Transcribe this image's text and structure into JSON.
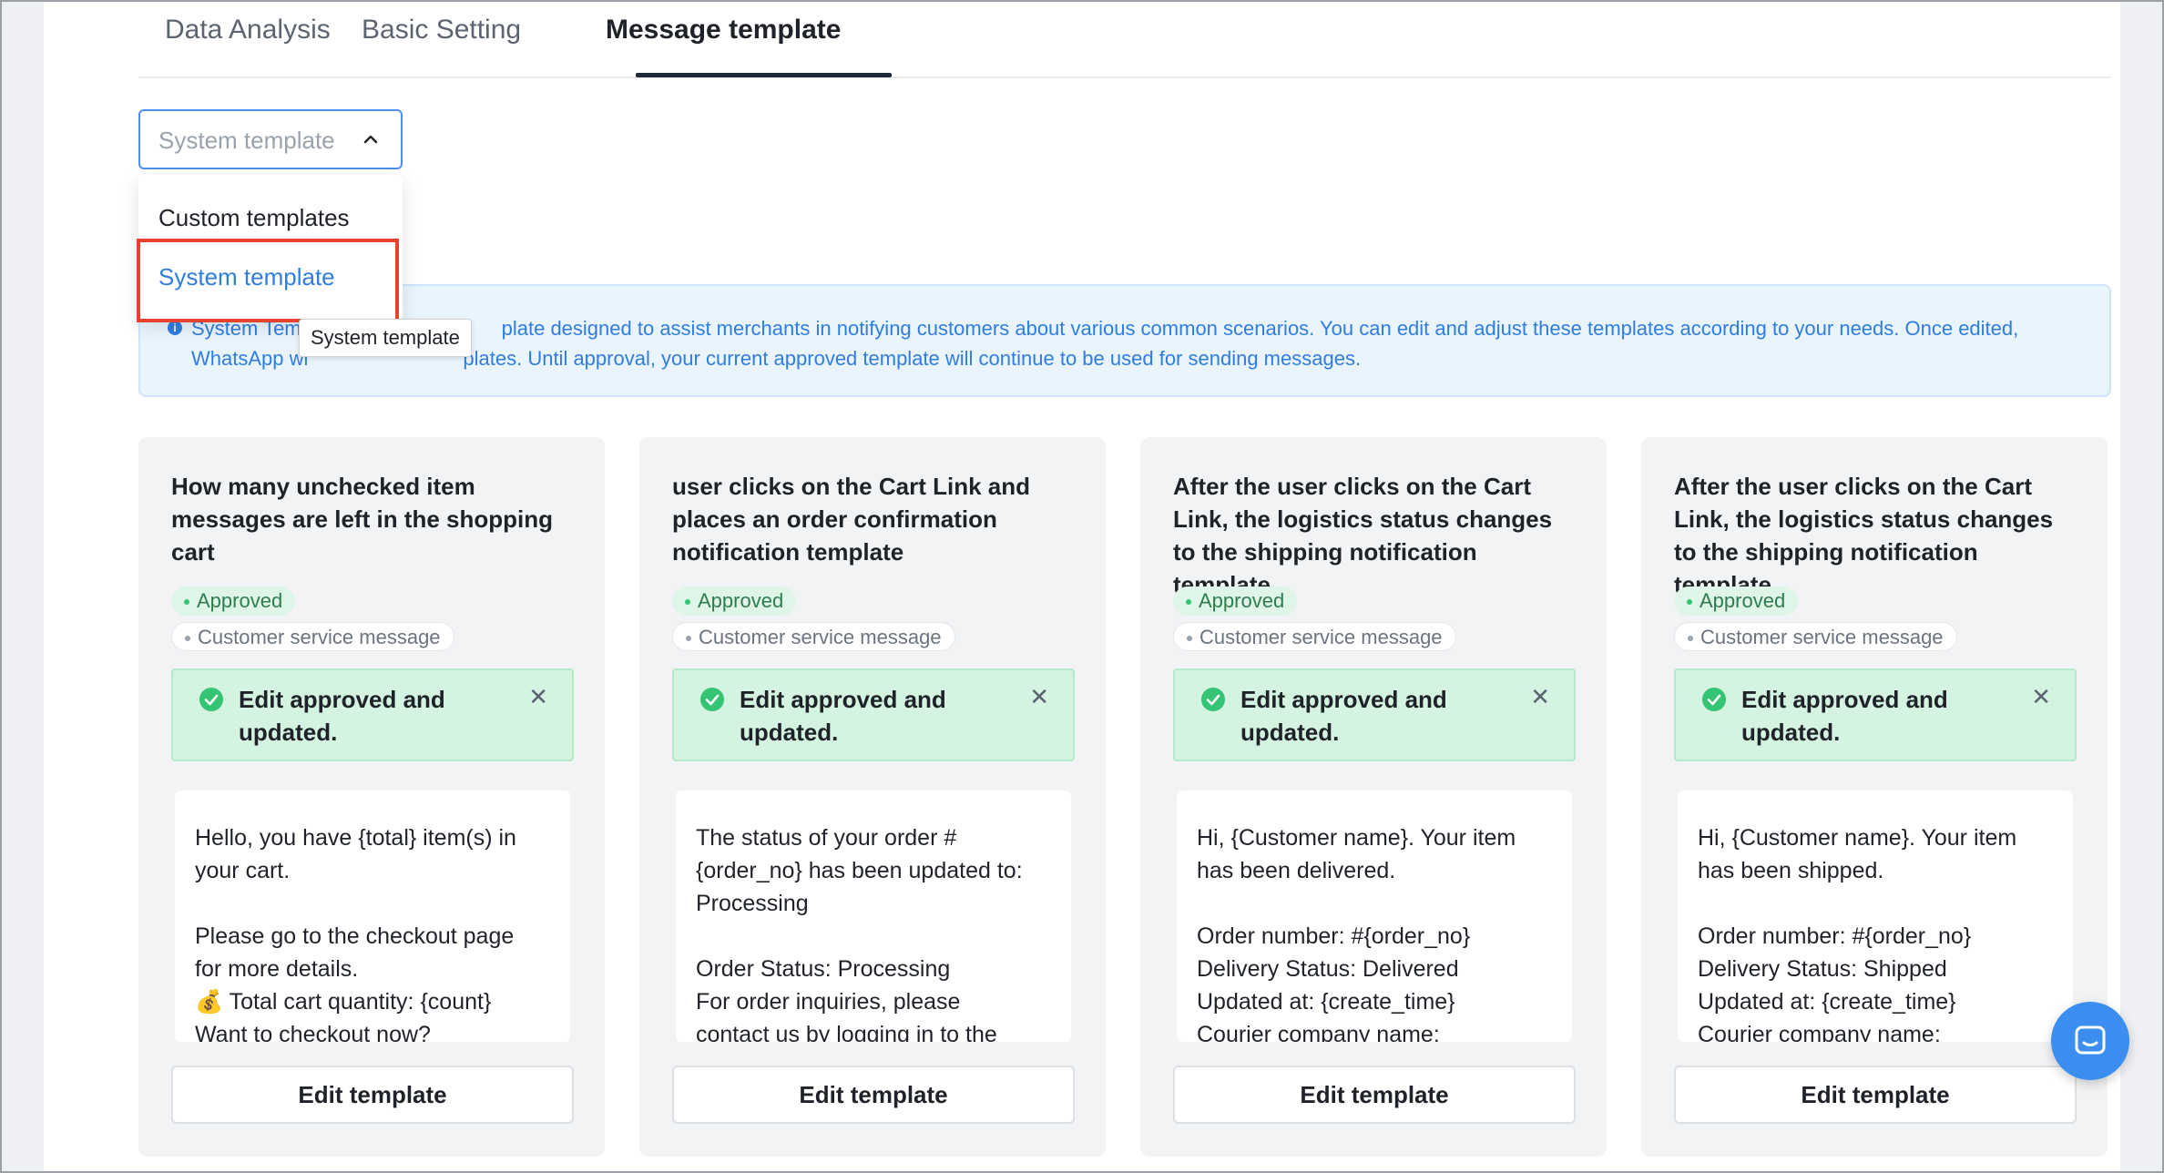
{
  "tabs": [
    {
      "label": "Data Analysis"
    },
    {
      "label": "Basic Setting"
    },
    {
      "label": "Message template"
    }
  ],
  "select": {
    "value": "System template",
    "options": [
      "Custom templates",
      "System template"
    ],
    "tooltip": "System template"
  },
  "banner": {
    "text_visible": "System Tem",
    "text_rest": "plate designed to assist merchants in notifying customers about various common scenarios. You can edit and adjust these templates according to your needs. Once edited,",
    "line2_start": "WhatsApp wi",
    "line2_end": "plates. Until approval, your current approved template will continue to be used for sending messages."
  },
  "cards": [
    {
      "title": "How many unchecked item messages are left in the shopping cart",
      "status": "Approved",
      "category": "Customer service message",
      "notice": "Edit approved and updated.",
      "preview": [
        "Hello, you have {total} item(s) in",
        "your cart.",
        "",
        "Please go to the checkout page",
        "for more details.",
        "💰 Total cart quantity: {count}",
        "Want to checkout now?"
      ],
      "button": "Edit template"
    },
    {
      "title": "user clicks on the Cart Link and places an order confirmation notification template",
      "status": "Approved",
      "category": "Customer service message",
      "notice": "Edit approved and updated.",
      "preview": [
        "The status of your order #",
        "{order_no} has been updated to:",
        "Processing",
        "",
        "Order Status: Processing",
        "For order inquiries, please",
        "contact us by logging in to the"
      ],
      "button": "Edit template"
    },
    {
      "title": "After the user clicks on the Cart Link, the logistics status changes to the shipping notification template",
      "status": "Approved",
      "category": "Customer service message",
      "notice": "Edit approved and updated.",
      "preview": [
        "Hi, {Customer name}. Your item",
        "has been delivered.",
        "",
        "Order number: #{order_no}",
        "Delivery Status: Delivered",
        "Updated at: {create_time}",
        "Courier company name:"
      ],
      "button": "Edit template"
    },
    {
      "title": "After the user clicks on the Cart Link, the logistics status changes to the shipping notification template",
      "status": "Approved",
      "category": "Customer service message",
      "notice": "Edit approved and updated.",
      "preview": [
        "Hi, {Customer name}. Your item",
        "has been shipped.",
        "",
        "Order number: #{order_no}",
        "Delivery Status: Shipped",
        "Updated at: {create_time}",
        "Courier company name:"
      ],
      "button": "Edit template"
    }
  ],
  "colors": {
    "accent": "#2f7de1",
    "highlight": "#e5432d",
    "success_bg": "#d4f3e0",
    "fab": "#3b8ef0"
  },
  "icons": {
    "chevron": "chevron-up-icon",
    "success": "check-circle-icon",
    "close": "close-icon",
    "info": "info-icon",
    "chat": "chat-icon"
  }
}
